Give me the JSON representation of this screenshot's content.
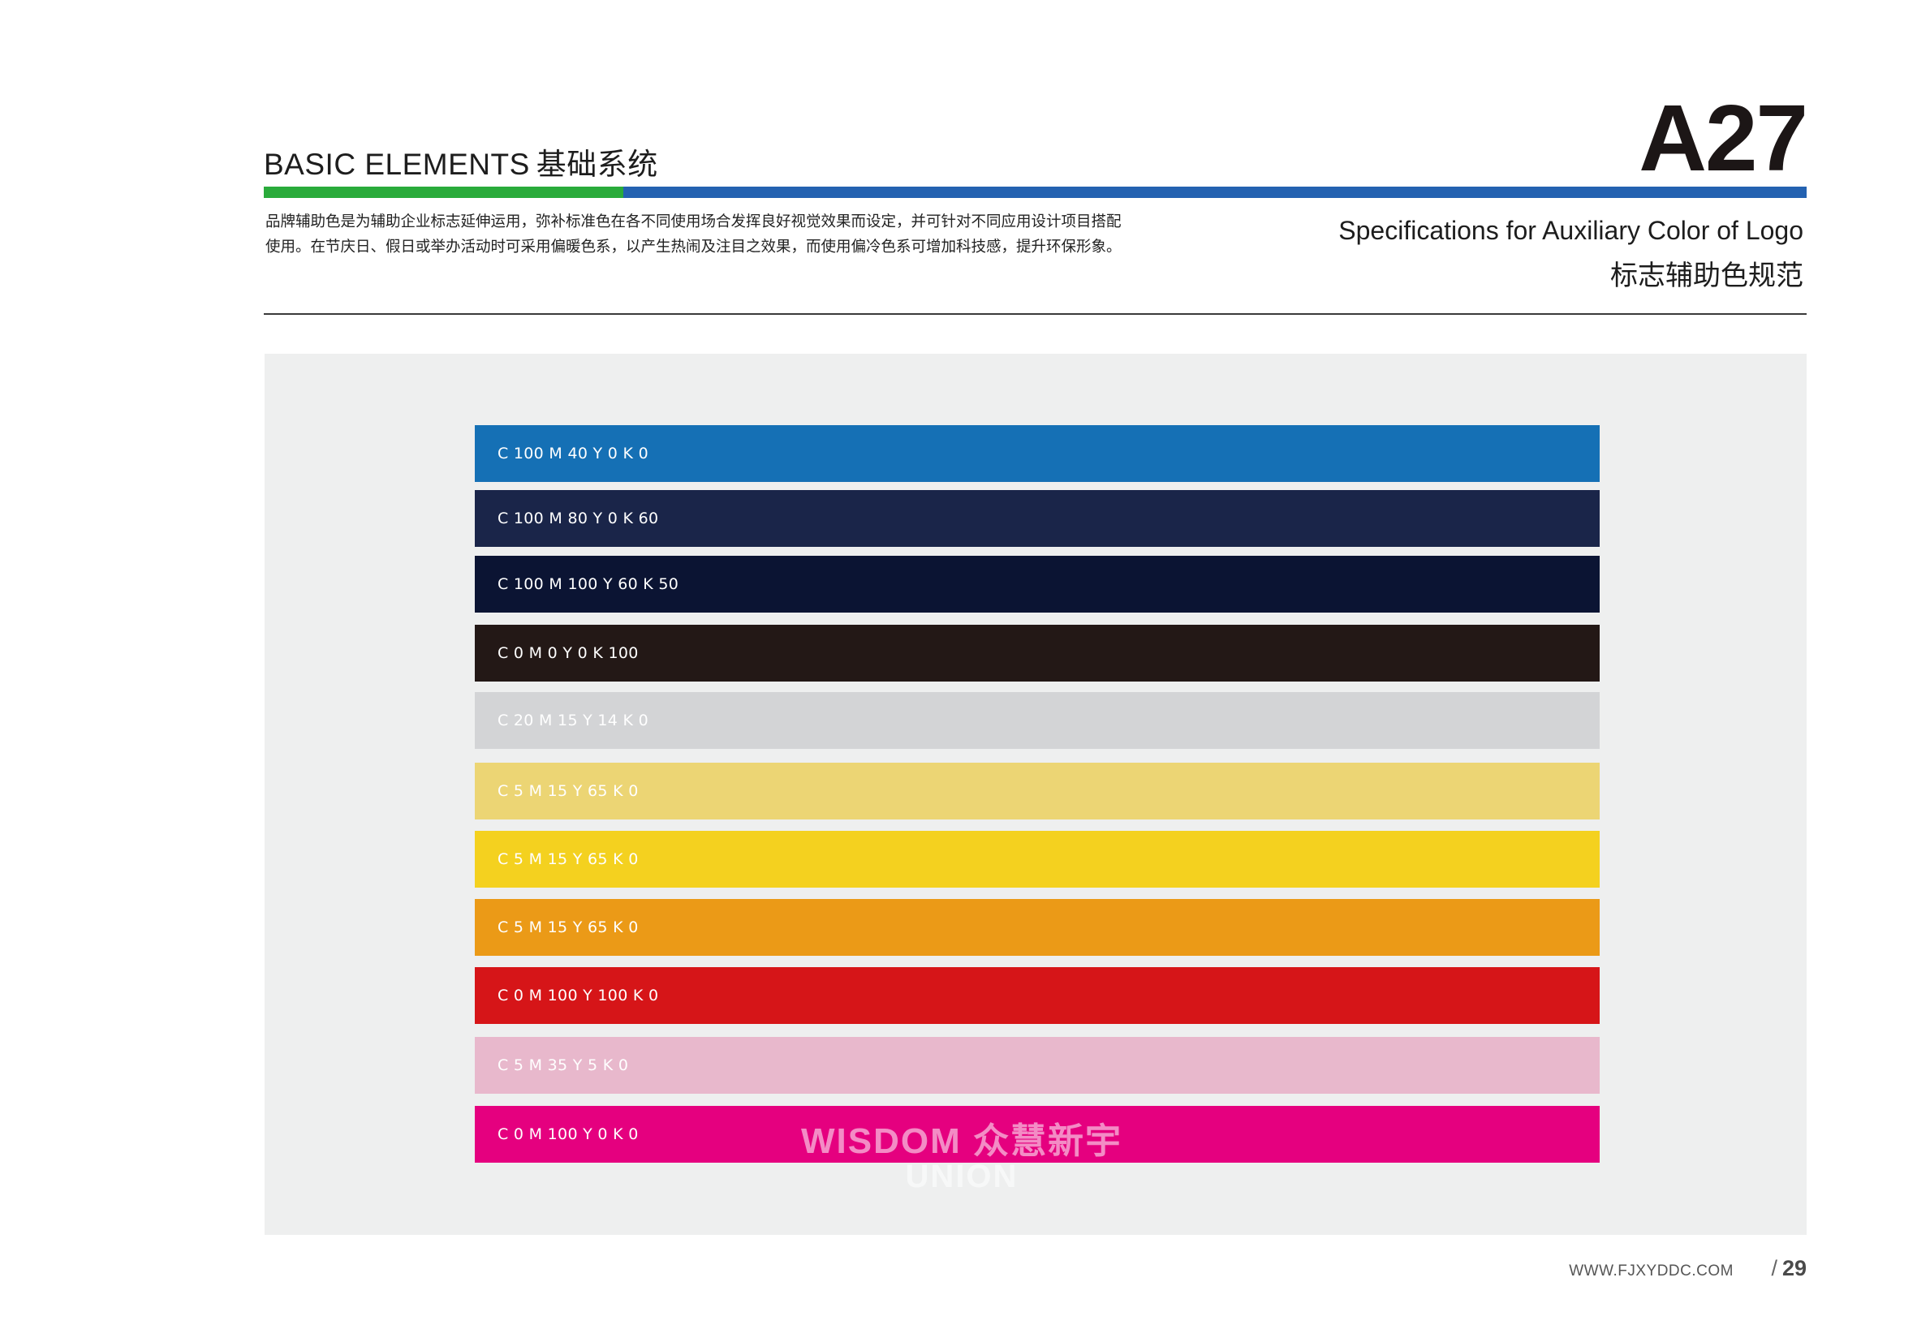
{
  "header": {
    "title_en": "BASIC ELEMENTS",
    "title_cn": "基础系统",
    "page_code": "A27"
  },
  "intro": {
    "line1": "品牌辅助色是为辅助企业标志延伸运用，弥补标准色在各不同使用场合发挥良好视觉效果而设定，并可针对不同应用设计项目搭配",
    "line2": "使用。在节庆日、假日或举办活动时可采用偏暖色系，以产生热闹及注目之效果，而使用偏冷色系可增加科技感，提升环保形象。"
  },
  "spec": {
    "title_en": "Specifications for Auxiliary Color of Logo",
    "title_cn": "标志辅助色规范"
  },
  "swatches": [
    {
      "label": "C 100 M 40 Y 0 K 0",
      "color": "#1570b5"
    },
    {
      "label": "C 100 M 80 Y 0 K 60",
      "color": "#1a2549"
    },
    {
      "label": "C 100 M 100 Y 60 K 50",
      "color": "#0b1433"
    },
    {
      "label": "C 0 M 0 Y 0 K 100",
      "color": "#231816"
    },
    {
      "label": "C 20 M 15 Y 14 K 0",
      "color": "#d3d4d6"
    },
    {
      "label": "C 5 M 15 Y 65 K 0",
      "color": "#ecd574"
    },
    {
      "label": "C 5 M 15 Y 65 K 0",
      "color": "#f4d11f"
    },
    {
      "label": "C 5 M 15 Y 65 K 0",
      "color": "#eb9a17"
    },
    {
      "label": "C 0 M 100 Y 100 K 0",
      "color": "#d61518"
    },
    {
      "label": "C 5 M 35 Y 5 K 0",
      "color": "#e8b8cc"
    },
    {
      "label": "C 0 M 100 Y 0 K 0",
      "color": "#e5007f"
    }
  ],
  "watermark": {
    "line1": "WISDOM 众慧新宇",
    "line2": "UNION"
  },
  "footer": {
    "url": "WWW.FJXYDDC.COM",
    "slash": "/",
    "page_number": "29"
  }
}
